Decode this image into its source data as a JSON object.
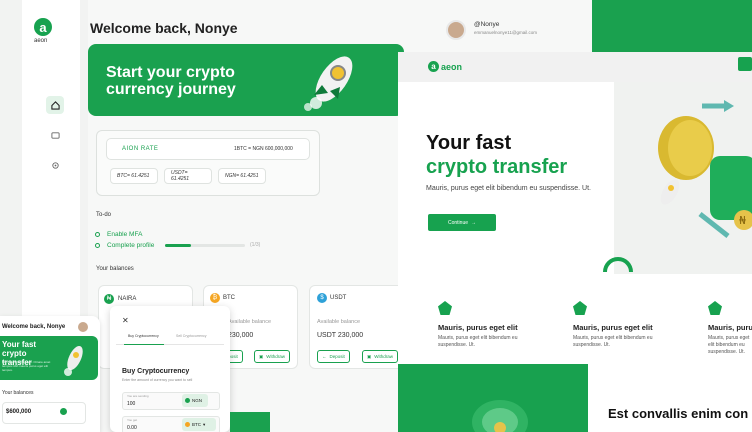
{
  "dashboard": {
    "logo_text": "aeon",
    "welcome": "Welcome back, Nonye",
    "hero_title": "Start your crypto currency journey",
    "rate": {
      "label": "AION RATE",
      "value": "1BTC = NGN 600,000,000",
      "pills": [
        "BTC= 61.4251",
        "USDT= 61.4251",
        "NGN= 61.4251"
      ]
    },
    "todo": {
      "heading": "To-do",
      "items": [
        "Enable MFA",
        "Complete profile"
      ],
      "progress_label": "(1/3)",
      "progress": 0.33
    },
    "balances": {
      "heading": "Your balances",
      "cards": [
        {
          "name": "NAIRA",
          "label": "",
          "amount": "",
          "color": "#19a14f"
        },
        {
          "name": "BTC",
          "label": "Available balance",
          "amount": "230,000",
          "deposit": "Deposit",
          "withdraw": "Withdraw",
          "color": "#f5a623"
        },
        {
          "name": "USDT",
          "label": "Available balance",
          "amount": "USDT 230,000",
          "deposit": "Deposit",
          "withdraw": "Withdraw",
          "color": "#2ea1d8"
        }
      ]
    },
    "user": {
      "name": "@Nonye",
      "email": "emmanuelnonye11@gmail.com"
    }
  },
  "landing": {
    "logo_text": "aeon",
    "title_line1": "Your fast",
    "title_line2": "crypto transfer",
    "subtitle": "Mauris, purus eget elit bibendum eu suspendisse. Ut.",
    "cta": "Continue",
    "features": [
      {
        "title": "Mauris, purus eget elit",
        "text": "Mauris, purus eget elit bibendum eu suspendisse. Ut."
      },
      {
        "title": "Mauris, purus eget elit",
        "text": "Mauris, purus eget elit bibendum eu suspendisse. Ut."
      },
      {
        "title": "Mauris, purus eget elit",
        "text": "Mauris, purus eget elit bibendum eu suspendisse. Ut."
      }
    ],
    "section_heading": "Est convallis enim con"
  },
  "mobile": {
    "welcome": "Welcome back, Nonye",
    "hero": "Your fast crypto transfer",
    "hero_text": "Elit Viverra Nulla Enim. Ornare amet tempus nibh mauris purus eget elit tempus.",
    "balances_heading": "Your balances",
    "amount": "$600,000"
  },
  "buy": {
    "close": "✕",
    "tabs": [
      "Buy Cryptocurrency",
      "Sell Cryptocurrency"
    ],
    "title": "Buy Cryptocurrency",
    "subtitle": "Enter the amount of currency you want to sell",
    "you_pay_label": "You are sending",
    "you_pay": "100",
    "pay_currency": "NGN",
    "you_get_label": "You get",
    "you_get": "0.00",
    "get_currency": "BTC"
  },
  "colors": {
    "brand": "#17a24f",
    "background": "#1aa14f"
  }
}
